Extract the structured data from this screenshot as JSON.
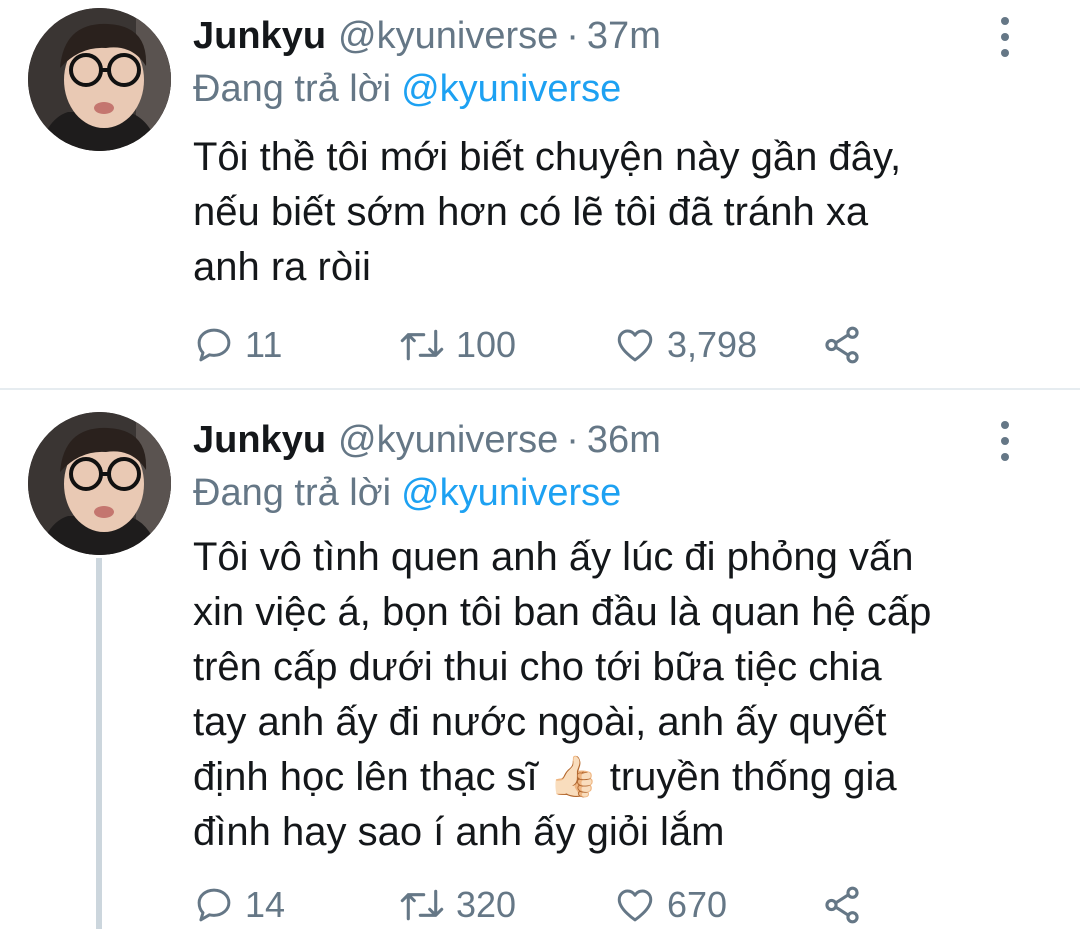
{
  "tweets": [
    {
      "name": "Junkyu",
      "handle": "@kyuniverse",
      "separator": "·",
      "time": "37m",
      "replying_label": "Đang trả lời",
      "replying_to": "@kyuniverse",
      "text_lines": [
        "Tôi thề tôi mới biết chuyện này gần đây,",
        "nếu biết sớm hơn có lẽ tôi đã tránh xa",
        "anh ra ròii"
      ],
      "replies": "11",
      "retweets": "100",
      "likes": "3,798"
    },
    {
      "name": "Junkyu",
      "handle": "@kyuniverse",
      "separator": "·",
      "time": "36m",
      "replying_label": "Đang trả lời",
      "replying_to": "@kyuniverse",
      "text_lines": [
        "Tôi vô tình quen anh ấy lúc đi phỏng vấn",
        "xin việc á, bọn tôi ban đầu là quan hệ cấp",
        "trên cấp dưới thui cho tới bữa tiệc chia",
        "tay anh ấy đi nước ngoài, anh ấy quyết",
        "định học lên thạc sĩ 👍🏻 truyền thống gia",
        "đình hay sao í anh ấy giỏi lắm"
      ],
      "replies": "14",
      "retweets": "320",
      "likes": "670"
    }
  ],
  "icons": {
    "reply": "reply-icon",
    "retweet": "retweet-icon",
    "like": "heart-icon",
    "share": "share-icon",
    "more": "more-options-icon"
  },
  "colors": {
    "text": "#14171a",
    "secondary": "#657786",
    "link": "#1da1f2",
    "divider": "#e6ecf0",
    "thread_line": "#ccd6dd"
  }
}
